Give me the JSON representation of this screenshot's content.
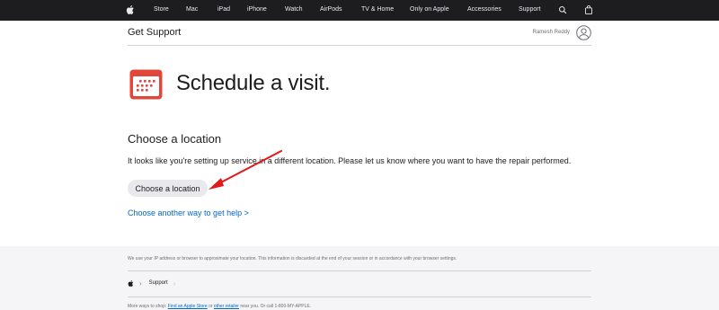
{
  "globalnav": {
    "items": [
      "Store",
      "Mac",
      "iPad",
      "iPhone",
      "Watch",
      "AirPods",
      "TV & Home",
      "Only on Apple",
      "Accessories",
      "Support"
    ],
    "icons": [
      "apple-logo",
      "search-icon",
      "bag-icon"
    ]
  },
  "subnav": {
    "title": "Get Support",
    "user_name": "Ramesh Reddy"
  },
  "hero": {
    "title": "Schedule a visit.",
    "icon": "calendar-icon",
    "icon_color": "#e2463b"
  },
  "section": {
    "title": "Choose a location",
    "text": "It looks like you're setting up service in a different location. Please let us know where you want to have the repair performed.",
    "button_label": "Choose a location",
    "link_label": "Choose another way to get help >"
  },
  "annotation": {
    "arrow_color": "#e0191b"
  },
  "footer": {
    "note": "We use your IP address or browser to approximate your location. This information is discarded at the end of your session or in accordance with your browser settings.",
    "breadcrumb": [
      "Support"
    ],
    "more_prefix": "More ways to shop:",
    "more_link": "Find an Apple Store",
    "more_or": "or",
    "more_link2": "other retailer",
    "more_suffix": "near you. Or call 1-800-MY-APPLE."
  },
  "colors": {
    "nav_bg": "#1d1d1f",
    "link": "#0066cc",
    "footer_bg": "#f5f5f7"
  }
}
